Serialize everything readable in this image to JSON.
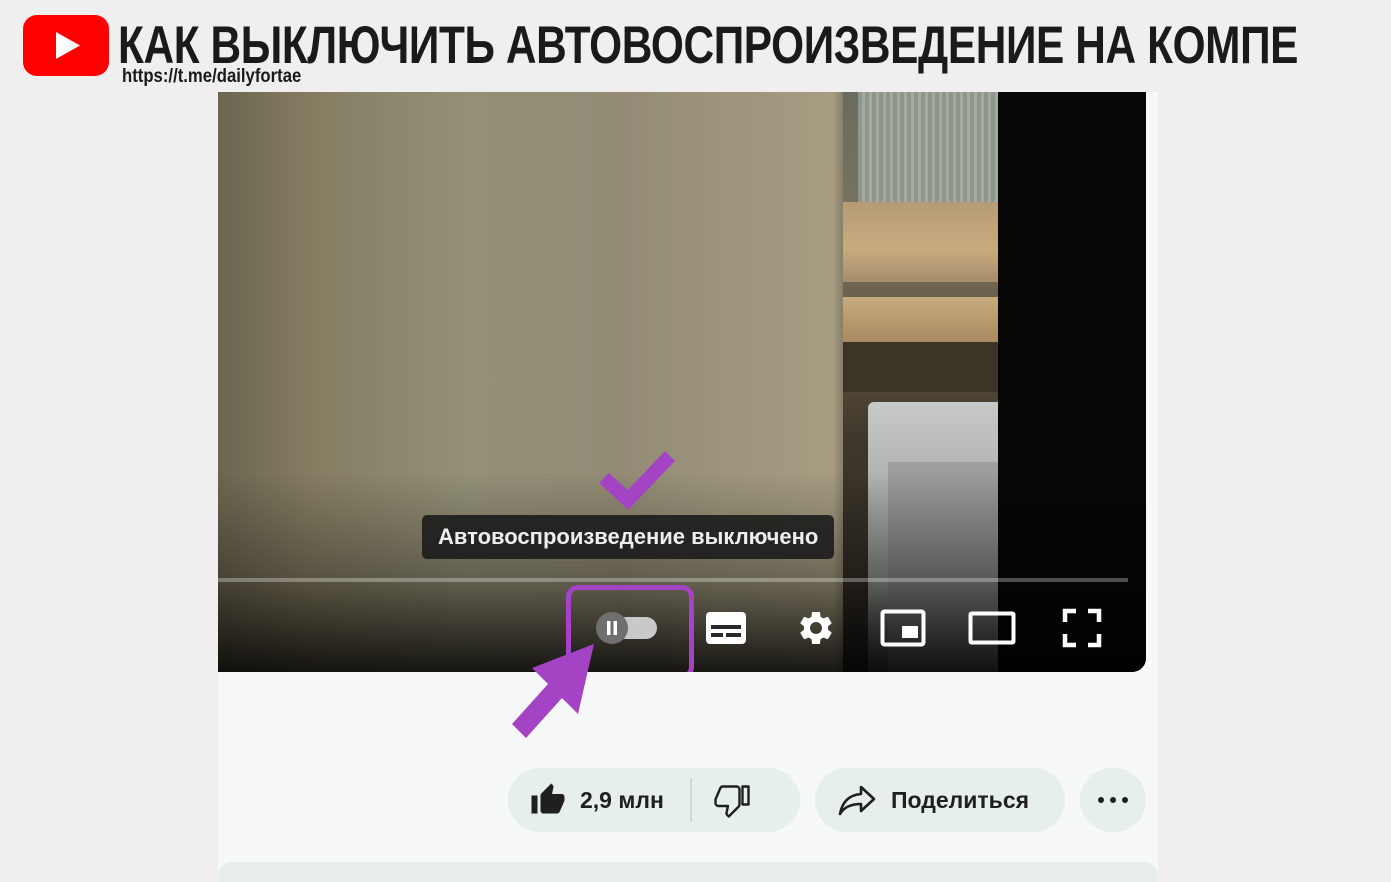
{
  "header": {
    "headline": "КАК ВЫКЛЮЧИТЬ АВТОВОСПРОИЗВЕДЕНИЕ НА КОМПЕ",
    "source_url": "https://t.me/dailyfortae",
    "logo_icon": "youtube-logo-icon"
  },
  "player": {
    "tooltip": "Автовоспроизведение выключено",
    "autoplay_enabled": false,
    "controls": [
      {
        "name": "autoplay-toggle",
        "icon": "pause-toggle-icon"
      },
      {
        "name": "subtitles-button",
        "icon": "subtitles-icon"
      },
      {
        "name": "settings-button",
        "icon": "gear-icon"
      },
      {
        "name": "miniplayer-button",
        "icon": "miniplayer-icon"
      },
      {
        "name": "theater-button",
        "icon": "theater-mode-icon"
      },
      {
        "name": "fullscreen-button",
        "icon": "fullscreen-icon"
      }
    ]
  },
  "actions": {
    "like_count": "2,9 млн",
    "share_label": "Поделиться",
    "like_icon": "thumbs-up-icon",
    "dislike_icon": "thumbs-down-icon",
    "share_icon": "share-arrow-icon",
    "more_icon": "more-horizontal-icon"
  },
  "annotations": {
    "highlight_color": "#a543c5",
    "checkmark_icon": "checkmark-icon",
    "pointer_icon": "pointer-arrow-icon"
  },
  "colors": {
    "page_background": "#f0eeef",
    "pill_background": "#e6eeee",
    "player_controls": "#ffffff"
  }
}
